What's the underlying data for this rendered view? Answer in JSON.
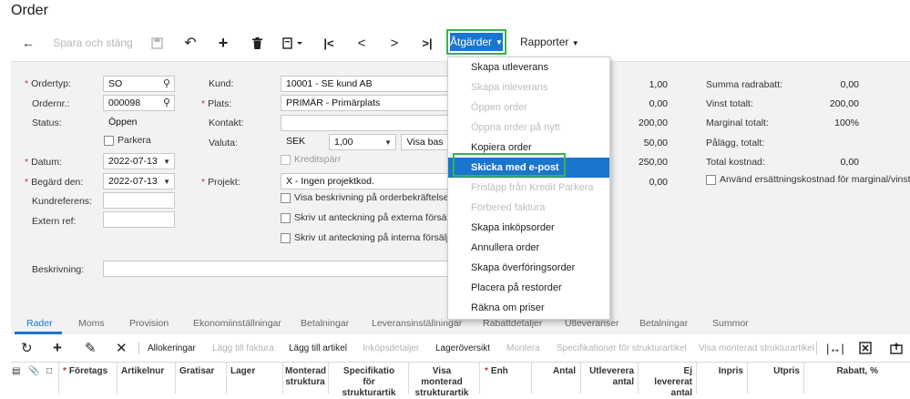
{
  "page": {
    "title": "Order"
  },
  "toolbar": {
    "save_close": "Spara och stäng",
    "actions": "Åtgärder",
    "reports": "Rapporter"
  },
  "form": {
    "ordertyp_label": "Ordertyp:",
    "ordertyp_value": "SO",
    "ordernr_label": "Ordernr.:",
    "ordernr_value": "000098",
    "status_label": "Status:",
    "status_value": "Öppen",
    "parkera_label": "Parkera",
    "datum_label": "Datum:",
    "datum_value": "2022-07-13",
    "begard_label": "Begärd den:",
    "begard_value": "2022-07-13",
    "kundref_label": "Kundreferens:",
    "externref_label": "Extern ref:",
    "beskrivning_label": "Beskrivning:",
    "kund_label": "Kund:",
    "kund_value": "10001 - SE kund AB",
    "plats_label": "Plats:",
    "plats_value": "PRIMÄR - Primärplats",
    "kontakt_label": "Kontakt:",
    "valuta_label": "Valuta:",
    "valuta_value": "SEK",
    "rate_value": "1,00",
    "visa_bas": "Visa bas",
    "kreditsparr_label": "Kreditspärr",
    "projekt_label": "Projekt:",
    "projekt_value": "X - Ingen projektkod.",
    "chk_visa_beskrivning": "Visa beskrivning på orderbekräftelse och",
    "chk_ext_anteckning": "Skriv ut anteckning på externa försäljnin",
    "chk_int_anteckning": "Skriv ut anteckning på interna försäljnin"
  },
  "totals_left": [
    "1,00",
    "0,00",
    "200,00",
    "50,00",
    "250,00",
    "0,00"
  ],
  "totals_right": {
    "summa_radrabatt_label": "Summa radrabatt:",
    "summa_radrabatt_value": "0,00",
    "vinst_label": "Vinst totalt:",
    "vinst_value": "200,00",
    "marginal_label": "Marginal totalt:",
    "marginal_value": "100%",
    "palagg_label": "Pålägg, totalt:",
    "total_kostnad_label": "Total kostnad:",
    "total_kostnad_value": "0,00",
    "ersattning_label": "Använd ersättningskostnad för marginal/vinst"
  },
  "menu": {
    "items": [
      "Skapa utleverans",
      "Skapa inleverans",
      "Öppen order",
      "Öppna order på nytt",
      "Kopiera order",
      "Skicka med e-post",
      "Frisläpp från Kredit Parkera",
      "Förbered faktura",
      "Skapa inköpsorder",
      "Annullera order",
      "Skapa överföringsorder",
      "Placera på restorder",
      "Räkna om priser"
    ]
  },
  "tabs": [
    "Rader",
    "Moms",
    "Provision",
    "Ekonomiinställningar",
    "Betalningar",
    "Leveransinställningar",
    "Rabattdetaljer",
    "Utleveranser",
    "Betalningar",
    "Summor"
  ],
  "grid_toolbar": {
    "allokeringar": "Allokeringar",
    "lagg_till_faktura": "Lägg till faktura",
    "lagg_till_artikel": "Lägg till artikel",
    "inkopsdetaljer": "Inköpsdetaljer",
    "lageroversikt": "Lageröversikt",
    "montera": "Montera",
    "spec_struktur": "Specifikationer för strukturartikel",
    "visa_monterad": "Visa monterad strukturartikel"
  },
  "grid_headers": {
    "foretags": "Företags",
    "artikelnr": "Artikelnur",
    "gratisar": "Gratisar",
    "lager": "Lager",
    "monterad": "Monterad",
    "monterad2": "struktura",
    "spec": "Specifikatio",
    "spec2": "för",
    "spec3": "strukturartik",
    "visa": "Visa",
    "visa2": "monterad",
    "visa3": "strukturartik",
    "enh": "Enh",
    "antal": "Antal",
    "utlevererat": "Utleverera",
    "utlevererat2": "antal",
    "ej": "Ej",
    "ej2": "levererat",
    "ej3": "antal",
    "inpris": "Inpris",
    "utpris": "Utpris",
    "rabatt": "Rabatt, %"
  },
  "colors": {
    "accent": "#1a75cf",
    "highlight": "#39b54a"
  }
}
